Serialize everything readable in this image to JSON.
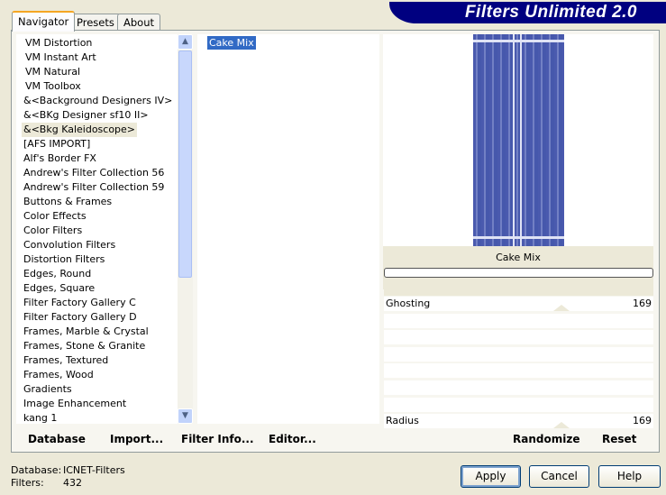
{
  "app": {
    "title": "Filters Unlimited 2.0"
  },
  "tabs": [
    {
      "label": "Navigator",
      "active": true
    },
    {
      "label": "Presets"
    },
    {
      "label": "About"
    }
  ],
  "categories": [
    "VM Distortion",
    "VM Instant Art",
    "VM Natural",
    "VM Toolbox",
    "&<Background Designers IV>",
    "&<BKg Designer sf10 II>",
    "&<Bkg Kaleidoscope>",
    "[AFS IMPORT]",
    "Alf's Border FX",
    "Andrew's Filter Collection 56",
    "Andrew's Filter Collection 59",
    "Buttons & Frames",
    "Color Effects",
    "Color Filters",
    "Convolution Filters",
    "Distortion Filters",
    "Edges, Round",
    "Edges, Square",
    "Filter Factory Gallery C",
    "Filter Factory Gallery D",
    "Frames, Marble & Crystal",
    "Frames, Stone & Granite",
    "Frames, Textured",
    "Frames, Wood",
    "Gradients",
    "Image Enhancement",
    "kang 1"
  ],
  "selected_category": "&<Bkg Kaleidoscope>",
  "filters": [
    "Cake Mix"
  ],
  "selected_filter": "Cake Mix",
  "preview": {
    "caption": "Cake Mix",
    "progress": 0
  },
  "sliders": [
    {
      "label": "Ghosting",
      "value": "169"
    },
    {
      "label": "",
      "value": ""
    },
    {
      "label": "",
      "value": ""
    },
    {
      "label": "",
      "value": ""
    },
    {
      "label": "",
      "value": ""
    },
    {
      "label": "",
      "value": ""
    },
    {
      "label": "",
      "value": ""
    },
    {
      "label": "Radius",
      "value": "169"
    }
  ],
  "left_buttons": {
    "database": "Database",
    "import": "Import...",
    "filter_info": "Filter Info...",
    "editor": "Editor..."
  },
  "right_buttons": {
    "randomize": "Randomize",
    "reset": "Reset"
  },
  "status": {
    "database_label": "Database:",
    "database_value": "ICNET-Filters",
    "filters_label": "Filters:",
    "filters_value": "432"
  },
  "dialog_buttons": {
    "apply": "Apply",
    "cancel": "Cancel",
    "help": "Help"
  },
  "colors": {
    "banner": "#000080",
    "selection": "#316ac5",
    "accent_tab": "#f5a623"
  }
}
